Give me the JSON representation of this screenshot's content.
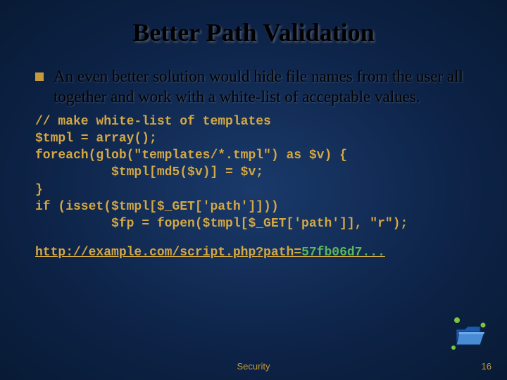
{
  "title": "Better Path Validation",
  "bullet": "An even better solution would hide file names from the user all together and work with a white-list of acceptable values.",
  "code": "// make white-list of templates\n$tmpl = array();\nforeach(glob(\"templates/*.tmpl\") as $v) {\n          $tmpl[md5($v)] = $v;\n}\nif (isset($tmpl[$_GET['path']]))\n          $fp = fopen($tmpl[$_GET['path']], \"r\");",
  "url_prefix": "http://example.com/script.php?path=",
  "url_hash": "57fb06d7...",
  "footer": "Security",
  "pagenum": "16"
}
